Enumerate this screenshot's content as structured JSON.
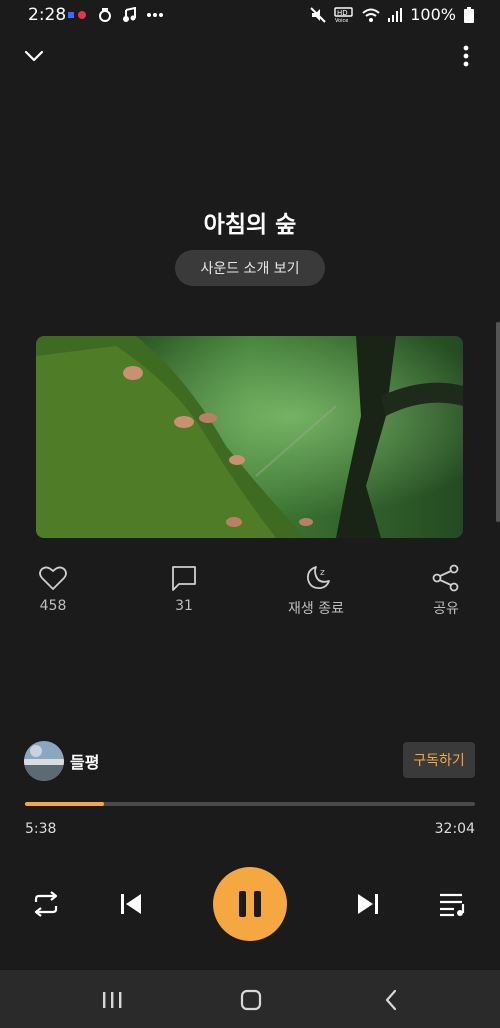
{
  "status_bar": {
    "time": "2:28",
    "battery": "100%",
    "icons": [
      "recording-dots-icon",
      "camera-icon",
      "music-note-icon",
      "more-dots-icon",
      "mute-icon",
      "hd-voice-icon",
      "wifi-icon",
      "signal-icon",
      "battery-icon"
    ]
  },
  "header": {
    "collapse_icon": "chevron-down-icon",
    "menu_icon": "more-vertical-icon"
  },
  "track": {
    "title": "아침의 숲",
    "sound_intro_label": "사운드 소개 보기"
  },
  "actions": [
    {
      "icon": "heart-icon",
      "label": "458"
    },
    {
      "icon": "comment-icon",
      "label": "31"
    },
    {
      "icon": "sleep-timer-icon",
      "label": "재생 종료"
    },
    {
      "icon": "share-icon",
      "label": "공유"
    }
  ],
  "channel": {
    "name": "들평",
    "subscribe_label": "구독하기"
  },
  "progress": {
    "current": "5:38",
    "total": "32:04",
    "fraction": 0.176
  },
  "controls": {
    "repeat_icon": "repeat-icon",
    "prev_icon": "skip-previous-icon",
    "play_pause_icon": "pause-icon",
    "next_icon": "skip-next-icon",
    "playlist_icon": "playlist-icon"
  },
  "colors": {
    "accent": "#f5a742",
    "background": "#1b1b1b",
    "button_bg": "#3a3a3a"
  }
}
